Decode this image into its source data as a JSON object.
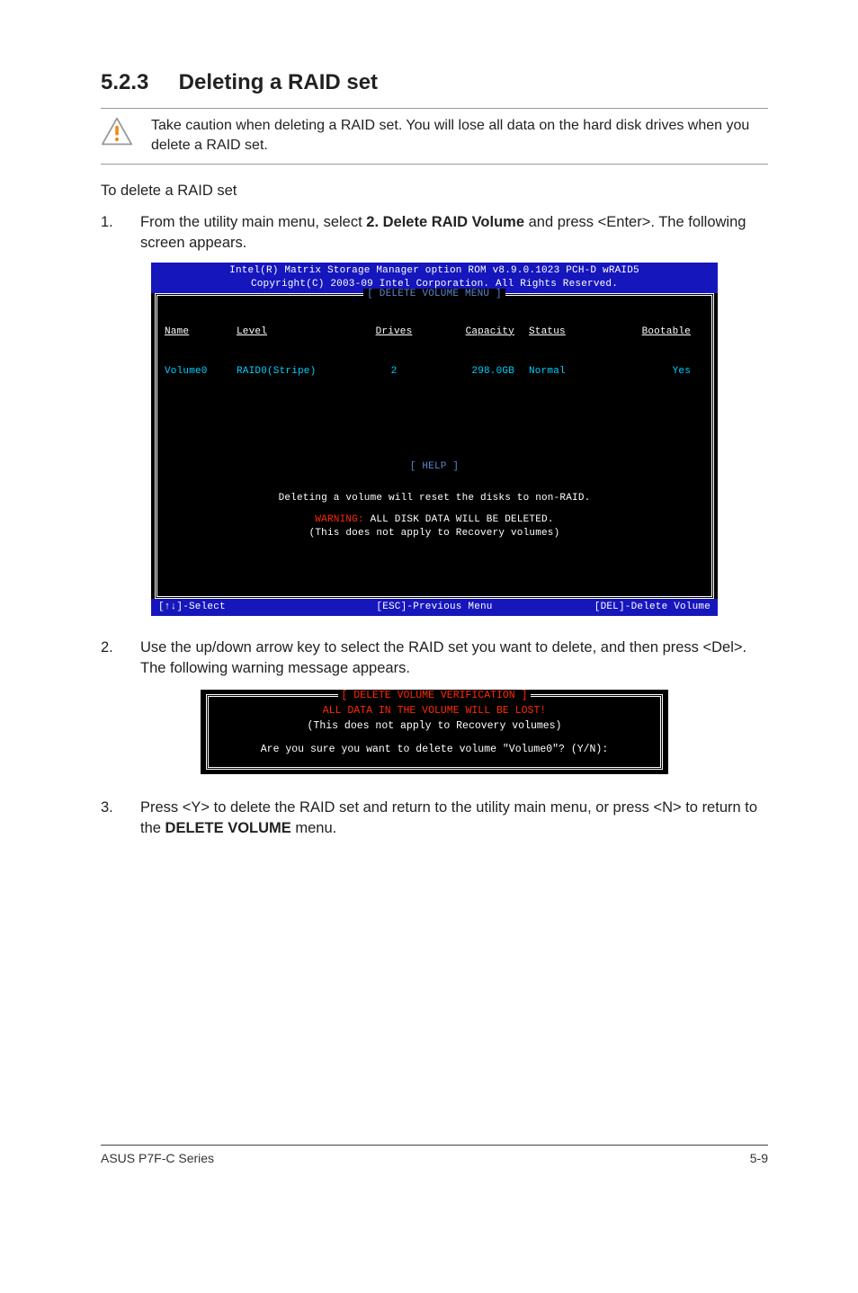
{
  "heading": {
    "number": "5.2.3",
    "title": "Deleting a RAID set"
  },
  "caution": "Take caution when deleting a RAID set. You will lose all data on the hard disk drives when you delete a RAID set.",
  "intro": "To delete a RAID set",
  "steps": {
    "s1": {
      "num": "1.",
      "pre": "From the utility main menu, select ",
      "bold": "2. Delete RAID Volume",
      "post": " and press <Enter>. The following screen appears."
    },
    "s2": {
      "num": "2.",
      "text": "Use the up/down arrow key to select the RAID set you want to delete, and then press <Del>. The following warning message appears."
    },
    "s3": {
      "num": "3.",
      "pre": "Press <Y> to delete the RAID set and return to the utility main menu, or press <N> to return to the ",
      "bold": "DELETE VOLUME",
      "post": " menu."
    }
  },
  "bios1": {
    "title1": "Intel(R) Matrix Storage Manager option ROM v8.9.0.1023 PCH-D wRAID5",
    "title2": "Copyright(C) 2003-09 Intel Corporation.  All Rights Reserved.",
    "frame_top": "[ DELETE VOLUME MENU ]",
    "headers": {
      "name": "Name",
      "level": "Level",
      "drives": "Drives",
      "capacity": "Capacity",
      "status": "Status",
      "bootable": "Bootable"
    },
    "row": {
      "name": "Volume0",
      "level": "RAID0(Stripe)",
      "drives": "2",
      "capacity": "298.0GB",
      "status": "Normal",
      "bootable": "Yes"
    },
    "frame_help": "[ HELP ]",
    "help1": "Deleting a volume will reset the disks to non-RAID.",
    "warn_label": "WARNING:",
    "warn_rest": " ALL DISK DATA WILL BE DELETED.",
    "help3": "(This does not apply to Recovery volumes)",
    "foot_left": "[↑↓]-Select",
    "foot_mid": "[ESC]-Previous Menu",
    "foot_right": "[DEL]-Delete Volume"
  },
  "bios2": {
    "frame": "[ DELETE VOLUME VERIFICATION ]",
    "lost": "ALL DATA IN THE VOLUME WILL BE LOST!",
    "line2": "(This does not apply to Recovery volumes)",
    "line3": "Are you sure you want to delete volume \"Volume0\"? (Y/N):"
  },
  "footer": {
    "left": "ASUS P7F-C Series",
    "right": "5-9"
  }
}
